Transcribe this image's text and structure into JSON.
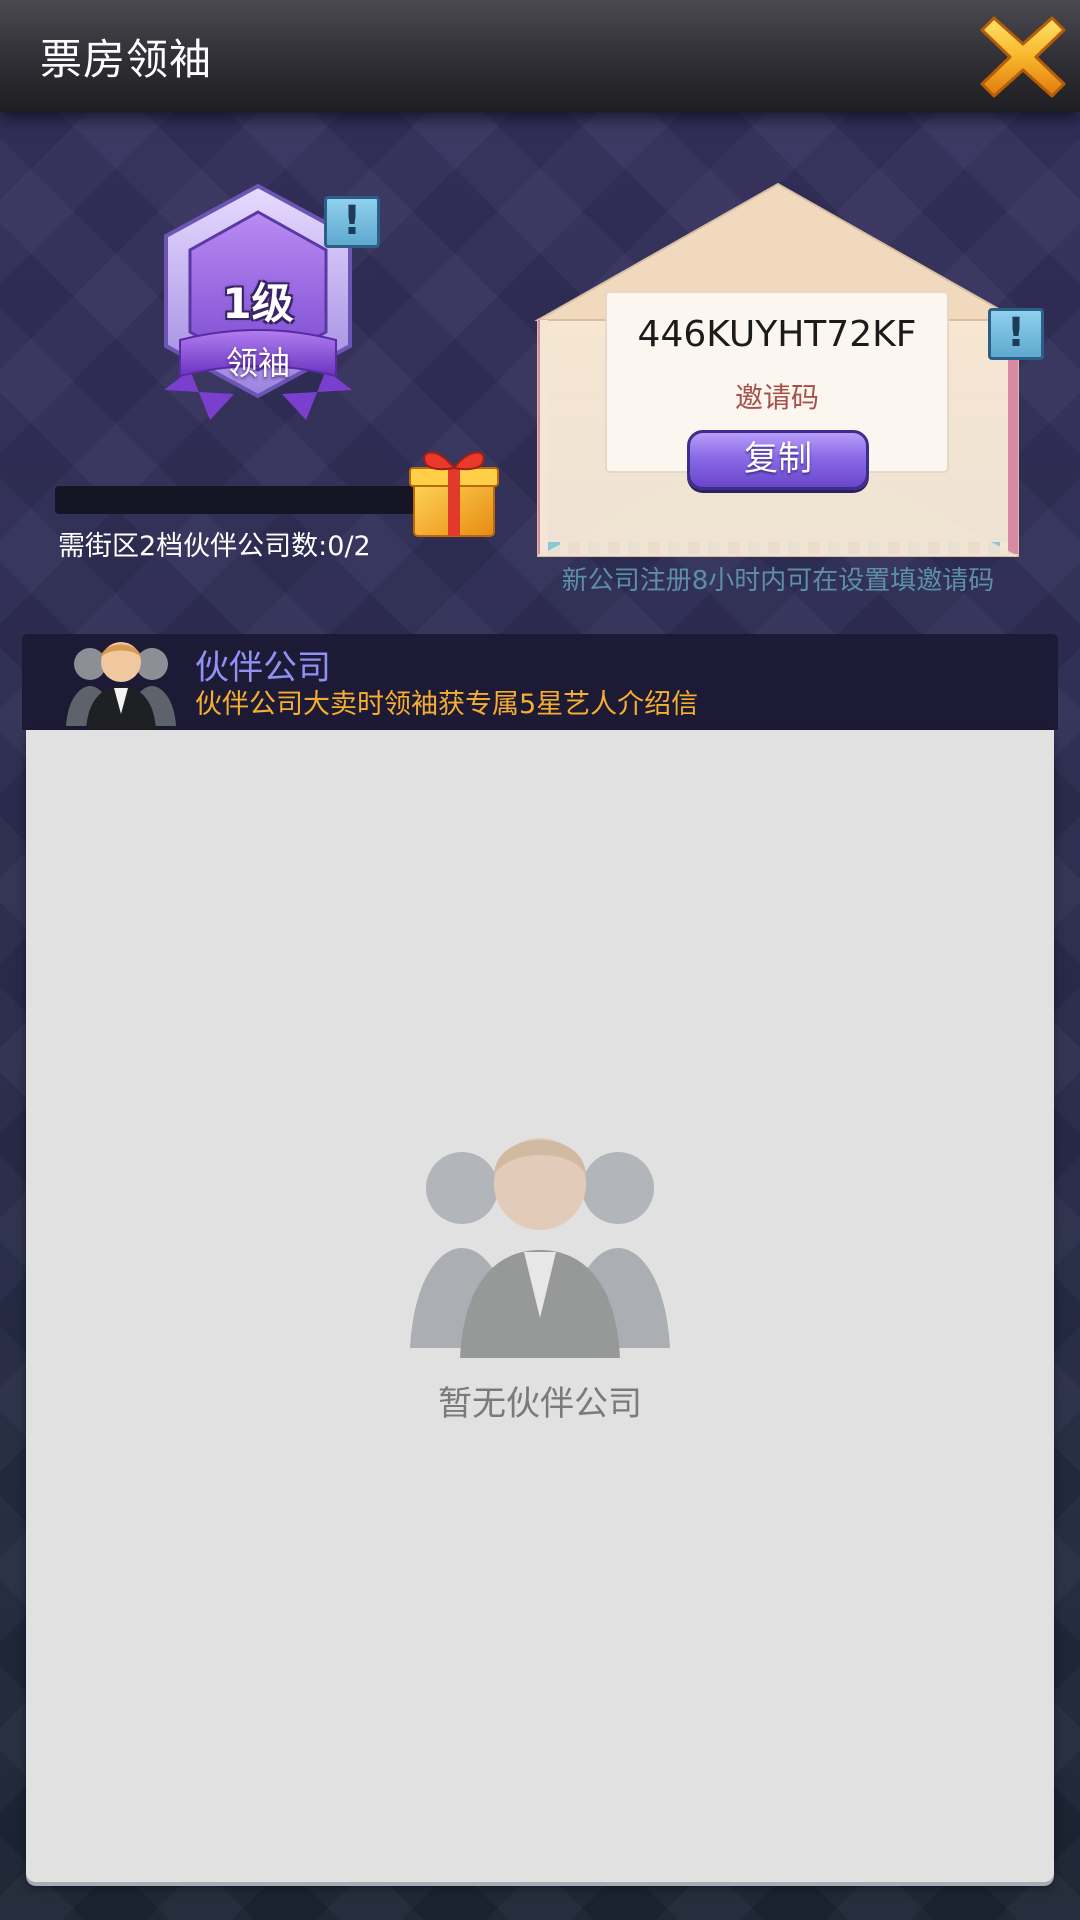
{
  "header": {
    "title": "票房领袖",
    "close_icon": "close-x-icon"
  },
  "leader": {
    "level": "1级",
    "title": "领袖",
    "progress_fraction": 0,
    "progress_text": "需街区2档伙伴公司数:0/2",
    "reward_icon": "gift-box-icon"
  },
  "invite": {
    "code": "446KUYHT72KF",
    "label": "邀请码",
    "copy_label": "复制",
    "note": "新公司注册8小时内可在设置填邀请码"
  },
  "partner": {
    "title": "伙伴公司",
    "description": "伙伴公司大卖时领袖获专属5星艺人介绍信",
    "empty_text": "暂无伙伴公司"
  },
  "colors": {
    "accent_purple": "#8a6ae6",
    "partner_title": "#8f91f4",
    "partner_desc": "#f6ae30",
    "invite_label": "#a8514a",
    "note": "#5d8eaa"
  }
}
